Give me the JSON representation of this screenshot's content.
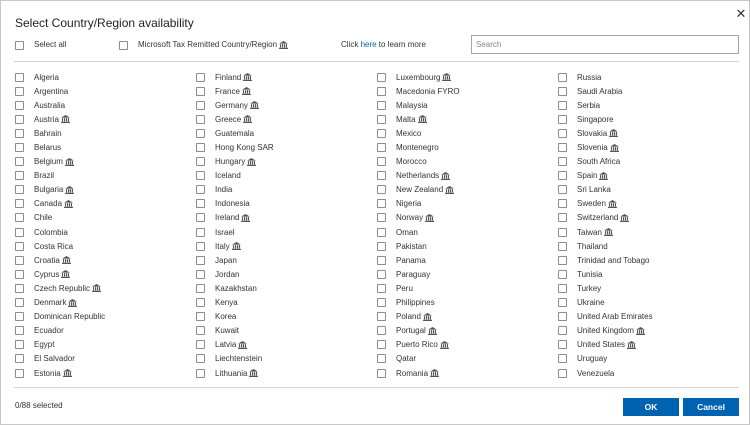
{
  "dialog": {
    "title": "Select Country/Region availability",
    "select_all_label": "Select all",
    "tax_remitted_label": "Microsoft Tax Remitted Country/Region",
    "learn_prefix": "Click ",
    "learn_link": "here",
    "learn_suffix": " to learn more",
    "search_placeholder": "Search",
    "selected_count": "0/88 selected",
    "ok_label": "OK",
    "cancel_label": "Cancel",
    "accent_color": "#0063b1"
  },
  "columns": [
    [
      {
        "name": "Algeria",
        "tax": false
      },
      {
        "name": "Argentina",
        "tax": false
      },
      {
        "name": "Australia",
        "tax": false
      },
      {
        "name": "Austria",
        "tax": true
      },
      {
        "name": "Bahrain",
        "tax": false
      },
      {
        "name": "Belarus",
        "tax": false
      },
      {
        "name": "Belgium",
        "tax": true
      },
      {
        "name": "Brazil",
        "tax": false
      },
      {
        "name": "Bulgaria",
        "tax": true
      },
      {
        "name": "Canada",
        "tax": true
      },
      {
        "name": "Chile",
        "tax": false
      },
      {
        "name": "Colombia",
        "tax": false
      },
      {
        "name": "Costa Rica",
        "tax": false
      },
      {
        "name": "Croatia",
        "tax": true
      },
      {
        "name": "Cyprus",
        "tax": true
      },
      {
        "name": "Czech Republic",
        "tax": true
      },
      {
        "name": "Denmark",
        "tax": true
      },
      {
        "name": "Dominican Republic",
        "tax": false
      },
      {
        "name": "Ecuador",
        "tax": false
      },
      {
        "name": "Egypt",
        "tax": false
      },
      {
        "name": "El Salvador",
        "tax": false
      },
      {
        "name": "Estonia",
        "tax": true
      }
    ],
    [
      {
        "name": "Finland",
        "tax": true
      },
      {
        "name": "France",
        "tax": true
      },
      {
        "name": "Germany",
        "tax": true
      },
      {
        "name": "Greece",
        "tax": true
      },
      {
        "name": "Guatemala",
        "tax": false
      },
      {
        "name": "Hong Kong SAR",
        "tax": false
      },
      {
        "name": "Hungary",
        "tax": true
      },
      {
        "name": "Iceland",
        "tax": false
      },
      {
        "name": "India",
        "tax": false
      },
      {
        "name": "Indonesia",
        "tax": false
      },
      {
        "name": "Ireland",
        "tax": true
      },
      {
        "name": "Israel",
        "tax": false
      },
      {
        "name": "Italy",
        "tax": true
      },
      {
        "name": "Japan",
        "tax": false
      },
      {
        "name": "Jordan",
        "tax": false
      },
      {
        "name": "Kazakhstan",
        "tax": false
      },
      {
        "name": "Kenya",
        "tax": false
      },
      {
        "name": "Korea",
        "tax": false
      },
      {
        "name": "Kuwait",
        "tax": false
      },
      {
        "name": "Latvia",
        "tax": true
      },
      {
        "name": "Liechtenstein",
        "tax": false
      },
      {
        "name": "Lithuania",
        "tax": true
      }
    ],
    [
      {
        "name": "Luxembourg",
        "tax": true
      },
      {
        "name": "Macedonia FYRO",
        "tax": false
      },
      {
        "name": "Malaysia",
        "tax": false
      },
      {
        "name": "Malta",
        "tax": true
      },
      {
        "name": "Mexico",
        "tax": false
      },
      {
        "name": "Montenegro",
        "tax": false
      },
      {
        "name": "Morocco",
        "tax": false
      },
      {
        "name": "Netherlands",
        "tax": true
      },
      {
        "name": "New Zealand",
        "tax": true
      },
      {
        "name": "Nigeria",
        "tax": false
      },
      {
        "name": "Norway",
        "tax": true
      },
      {
        "name": "Oman",
        "tax": false
      },
      {
        "name": "Pakistan",
        "tax": false
      },
      {
        "name": "Panama",
        "tax": false
      },
      {
        "name": "Paraguay",
        "tax": false
      },
      {
        "name": "Peru",
        "tax": false
      },
      {
        "name": "Philippines",
        "tax": false
      },
      {
        "name": "Poland",
        "tax": true
      },
      {
        "name": "Portugal",
        "tax": true
      },
      {
        "name": "Puerto Rico",
        "tax": true
      },
      {
        "name": "Qatar",
        "tax": false
      },
      {
        "name": "Romania",
        "tax": true
      }
    ],
    [
      {
        "name": "Russia",
        "tax": false
      },
      {
        "name": "Saudi Arabia",
        "tax": false
      },
      {
        "name": "Serbia",
        "tax": false
      },
      {
        "name": "Singapore",
        "tax": false
      },
      {
        "name": "Slovakia",
        "tax": true
      },
      {
        "name": "Slovenia",
        "tax": true
      },
      {
        "name": "South Africa",
        "tax": false
      },
      {
        "name": "Spain",
        "tax": true
      },
      {
        "name": "Sri Lanka",
        "tax": false
      },
      {
        "name": "Sweden",
        "tax": true
      },
      {
        "name": "Switzerland",
        "tax": true
      },
      {
        "name": "Taiwan",
        "tax": true
      },
      {
        "name": "Thailand",
        "tax": false
      },
      {
        "name": "Trinidad and Tobago",
        "tax": false
      },
      {
        "name": "Tunisia",
        "tax": false
      },
      {
        "name": "Turkey",
        "tax": false
      },
      {
        "name": "Ukraine",
        "tax": false
      },
      {
        "name": "United Arab Emirates",
        "tax": false
      },
      {
        "name": "United Kingdom",
        "tax": true
      },
      {
        "name": "United States",
        "tax": true
      },
      {
        "name": "Uruguay",
        "tax": false
      },
      {
        "name": "Venezuela",
        "tax": false
      }
    ]
  ]
}
